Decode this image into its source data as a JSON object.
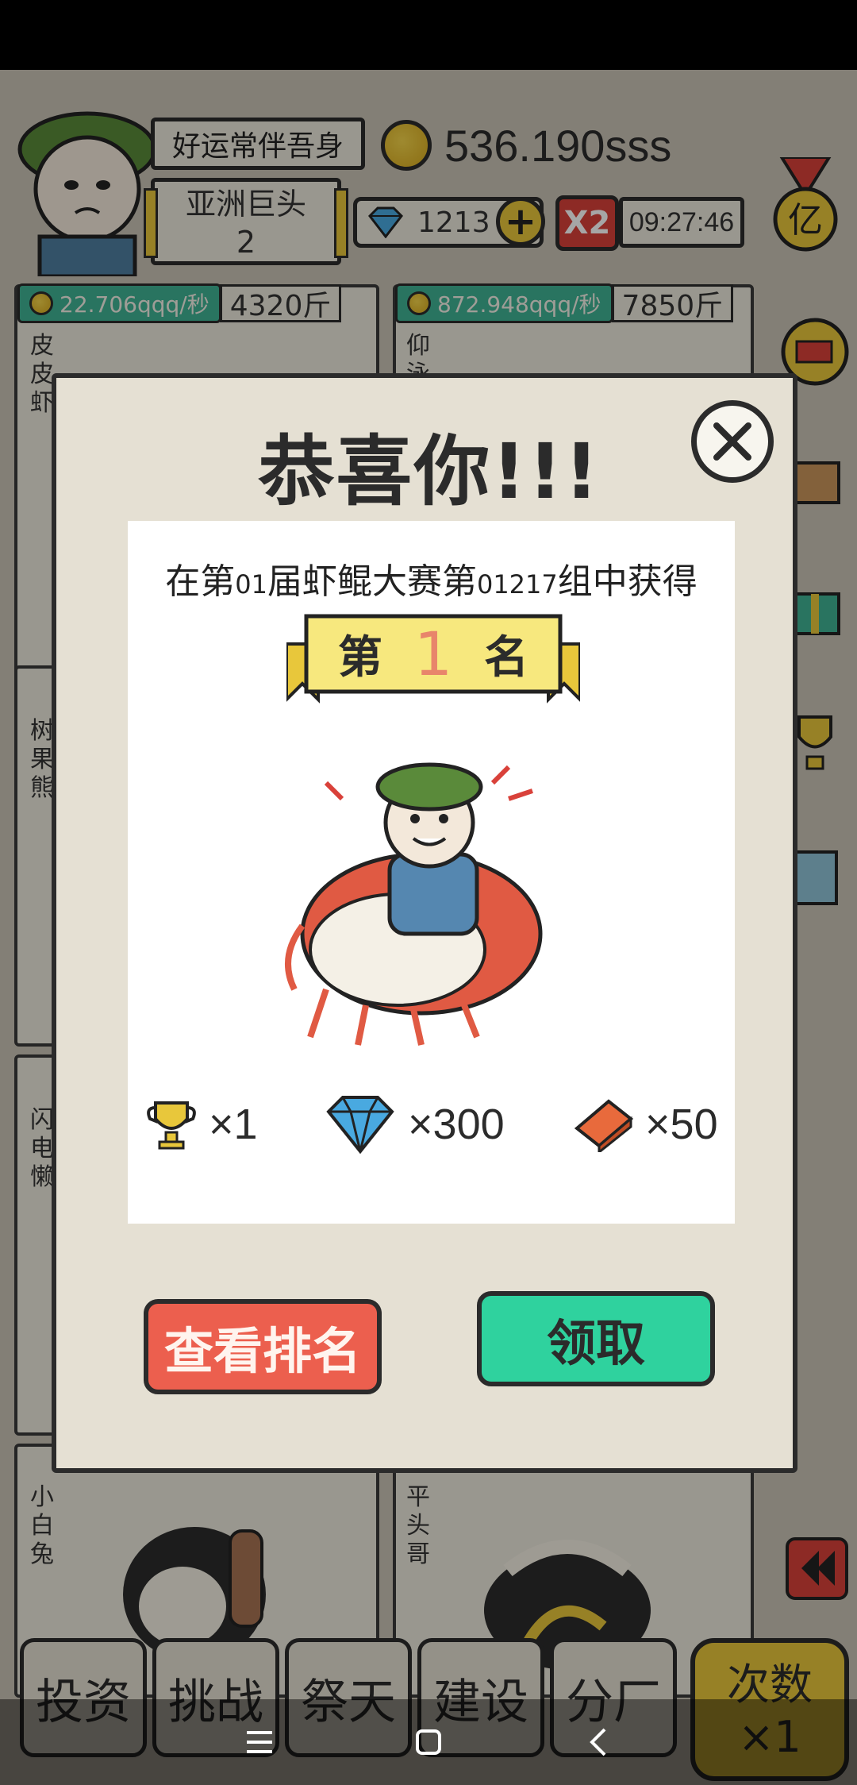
{
  "hud": {
    "player_title": "好运常伴吾身",
    "rank_title": "亚洲巨头",
    "rank_level": "2",
    "coins": "536.190sss",
    "gems": "1213",
    "multiplier": "X2",
    "timer": "09:27:46",
    "medal_char": "亿"
  },
  "cards": [
    {
      "income": "22.706qqq/秒",
      "weight": "4320斤",
      "name": "皮皮虾"
    },
    {
      "income": "872.948qqq/秒",
      "weight": "7850斤",
      "name": "仰泳"
    },
    {
      "name": "树果熊"
    },
    {
      "name": "闪电懒"
    },
    {
      "name": "小白兔"
    },
    {
      "name": "平头哥"
    }
  ],
  "dialog": {
    "title": "恭喜你!!!",
    "line_prefix": "在第",
    "session": "01",
    "line_mid1": "届虾鲲大赛第",
    "group": "01217",
    "line_mid2": "组中获得",
    "rank_prefix": "第",
    "rank": "1",
    "rank_suffix": "名",
    "rewards": [
      {
        "icon": "trophy-icon",
        "amount": "×1"
      },
      {
        "icon": "diamond-icon",
        "amount": "×300"
      },
      {
        "icon": "brick-icon",
        "amount": "×50"
      }
    ],
    "view_rank_label": "查看排名",
    "claim_label": "领取"
  },
  "bottom_nav": {
    "items": [
      "投资",
      "挑战",
      "祭天",
      "建设",
      "分厂"
    ],
    "count_label": "次数",
    "count_value": "×1"
  },
  "colors": {
    "accent_green": "#2fd29e",
    "accent_red": "#ec5f4e",
    "gold": "#e8c73b",
    "rank_number": "#e8856b"
  }
}
